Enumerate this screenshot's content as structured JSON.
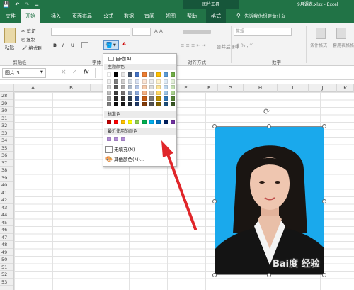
{
  "qat": {
    "save": "💾",
    "undo": "↶",
    "redo": "↷",
    "customize": "="
  },
  "title": {
    "contextual_group": "图片工具",
    "file_name": "9月课表.xlsx - Excel"
  },
  "tabs": [
    "文件",
    "开始",
    "插入",
    "页面布局",
    "公式",
    "数据",
    "审阅",
    "视图",
    "帮助",
    "格式"
  ],
  "tell_me": "告诉我你想要做什么",
  "ribbon": {
    "paste": "粘贴",
    "cut": "剪切",
    "copy": "复制",
    "format_painter": "格式刷",
    "clipboard_group": "剪贴板",
    "font_group": "字体",
    "alignment_group": "对齐方式",
    "number_group": "数字",
    "merge_center": "合并后居中",
    "number_format": "常规",
    "conditional_format": "条件格式",
    "cell_styles": "套用表格格式",
    "bold": "B",
    "italic": "I",
    "underline": "U"
  },
  "formula_bar": {
    "name_box": "图片 3",
    "cancel": "×",
    "enter": "✓",
    "fx": "fx",
    "value": ""
  },
  "columns": [
    "A",
    "B",
    "C",
    "D",
    "E",
    "F",
    "G",
    "H",
    "I",
    "J",
    "K"
  ],
  "rows": [
    "28",
    "29",
    "30",
    "31",
    "32",
    "33",
    "34",
    "35",
    "36",
    "37",
    "38",
    "39",
    "40",
    "41",
    "42",
    "43",
    "44",
    "45",
    "46",
    "47",
    "48",
    "49",
    "50",
    "51",
    "52",
    "53"
  ],
  "color_menu": {
    "automatic": "自动(A)",
    "theme_header": "主题颜色",
    "standard_header": "标准色",
    "recent_header": "最近使用的颜色",
    "no_fill": "无填充(N)",
    "more_colors": "其他颜色(M)...",
    "theme_top": [
      "#ffffff",
      "#000000",
      "#e7e6e6",
      "#44546a",
      "#4472c4",
      "#ed7d31",
      "#a5a5a5",
      "#ffc000",
      "#5b9bd5",
      "#70ad47"
    ],
    "theme_shades": [
      [
        "#f2f2f2",
        "#7f7f7f",
        "#d0cece",
        "#d6dce4",
        "#d9e2f3",
        "#fbe4d5",
        "#ededed",
        "#fff2cc",
        "#deebf6",
        "#e2efd9"
      ],
      [
        "#d8d8d8",
        "#595959",
        "#aeabab",
        "#adb9ca",
        "#b4c6e7",
        "#f7cbac",
        "#dbdbdb",
        "#fee599",
        "#bdd7ee",
        "#c5e0b3"
      ],
      [
        "#bfbfbf",
        "#3f3f3f",
        "#757070",
        "#8496b0",
        "#8eaadb",
        "#f4b183",
        "#c9c9c9",
        "#ffd965",
        "#9cc3e5",
        "#a8d08d"
      ],
      [
        "#a5a5a5",
        "#262626",
        "#3a3838",
        "#323f4f",
        "#2f5496",
        "#c55a11",
        "#7b7b7b",
        "#bf9000",
        "#2e75b5",
        "#538135"
      ],
      [
        "#7f7f7f",
        "#0c0c0c",
        "#171616",
        "#222a35",
        "#1f3864",
        "#833c0b",
        "#525252",
        "#7f6000",
        "#1e4e79",
        "#375623"
      ]
    ],
    "standard": [
      "#c00000",
      "#ff0000",
      "#ffc000",
      "#ffff00",
      "#92d050",
      "#00b050",
      "#00b0f0",
      "#0070c0",
      "#002060",
      "#7030a0"
    ],
    "recent": [
      "#b48fd8",
      "#b48fd8",
      "#b48fd8"
    ]
  },
  "photo": {
    "background": "#1aa9ec"
  },
  "watermark": "Bai度 经验",
  "colors": {
    "excel_green": "#217346",
    "arrow": "#e0262a"
  }
}
